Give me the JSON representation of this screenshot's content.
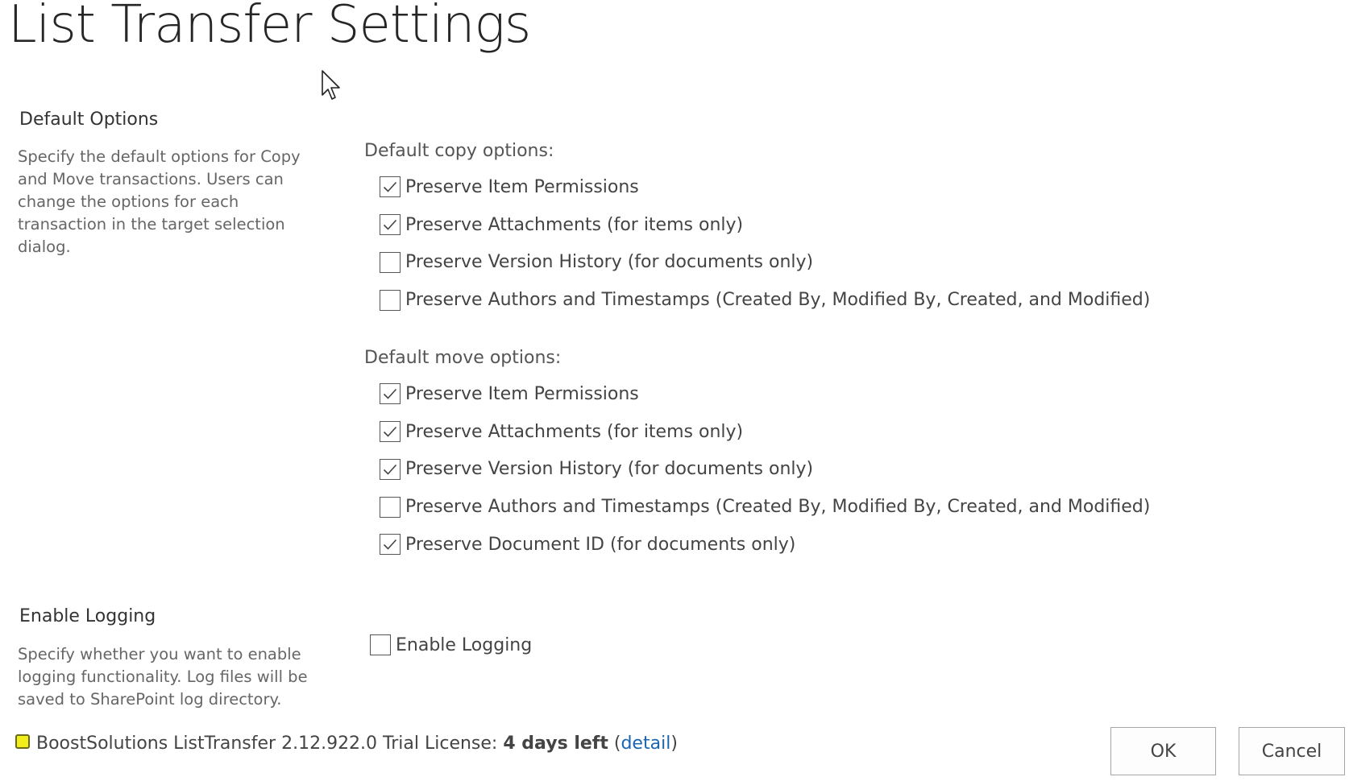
{
  "page_title": "List Transfer Settings",
  "default_options": {
    "title": "Default Options",
    "description": "Specify the default options for Copy and Move transactions. Users can change the options for each transaction in the target selection dialog.",
    "copy": {
      "label": "Default copy options:",
      "options": [
        {
          "label": "Preserve Item Permissions",
          "checked": true
        },
        {
          "label": "Preserve Attachments (for items only)",
          "checked": true
        },
        {
          "label": "Preserve Version History (for documents only)",
          "checked": false
        },
        {
          "label": "Preserve Authors and Timestamps (Created By, Modified By, Created, and Modified)",
          "checked": false
        }
      ]
    },
    "move": {
      "label": "Default move options:",
      "options": [
        {
          "label": "Preserve Item Permissions",
          "checked": true
        },
        {
          "label": "Preserve Attachments (for items only)",
          "checked": true
        },
        {
          "label": "Preserve Version History (for documents only)",
          "checked": true
        },
        {
          "label": "Preserve Authors and Timestamps (Created By, Modified By, Created, and Modified)",
          "checked": false
        },
        {
          "label": "Preserve Document ID (for documents only)",
          "checked": true
        }
      ]
    }
  },
  "logging": {
    "title": "Enable Logging",
    "description": "Specify whether you want to enable logging functionality. Log files will be saved to SharePoint log directory.",
    "option_label": "Enable Logging",
    "checked": false
  },
  "license": {
    "text": "BoostSolutions ListTransfer 2.12.922.0 Trial License:",
    "days_left": "4 days left",
    "open_paren": "(",
    "detail_link": "detail",
    "close_paren": ")",
    "icon": "license-status-icon",
    "icon_color": "#f2ee1c"
  },
  "buttons": {
    "ok": "OK",
    "cancel": "Cancel"
  },
  "colors": {
    "link": "#1a66b0",
    "title": "#262626",
    "description": "#666666"
  }
}
